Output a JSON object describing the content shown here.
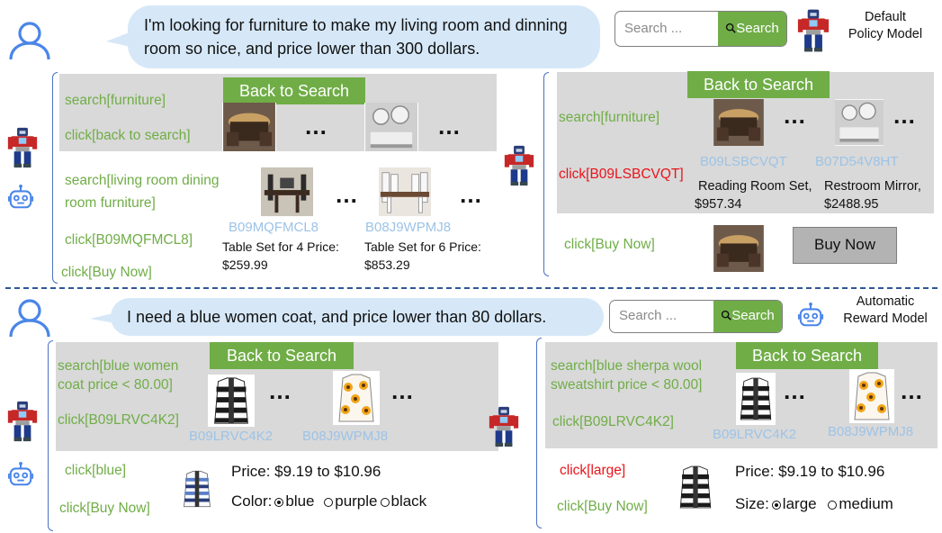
{
  "top": {
    "query": "I'm looking for furniture to make my living room and dinning room so nice, and price lower than 300 dollars.",
    "search_placeholder": "Search ...",
    "search_button": "Search",
    "model_label_line1": "Default",
    "model_label_line2": "Policy Model",
    "left": {
      "back_button": "Back to Search",
      "dots": "…",
      "cmd1": "search[furniture]",
      "cmd2": "click[back to search]",
      "cmd3_line1": "search[living room dining",
      "cmd3_line2": "room furniture]",
      "cmd4": "click[B09MQFMCL8]",
      "cmd5": "click[Buy Now]",
      "asin1": "B09MQFMCL8",
      "asin2": "B08J9WPMJ8",
      "desc1_line1": "Table Set for 4 Price:",
      "desc1_line2": "$259.99",
      "desc2_line1": "Table Set for 6 Price:",
      "desc2_line2": "$853.29"
    },
    "right": {
      "back_button": "Back to Search",
      "dots": "…",
      "cmd1": "search[furniture]",
      "cmd2": "click[B09LSBCVQT]",
      "cmd3": "click[Buy Now]",
      "asin1": "B09LSBCVQT",
      "asin2": "B07D54V8HT",
      "desc1_line1": "Reading Room Set,",
      "desc1_line2": "$957.34",
      "desc2_line1": "Restroom Mirror,",
      "desc2_line2": "$2488.95",
      "buy_now": "Buy Now"
    }
  },
  "bottom": {
    "query": "I need a blue women coat, and price lower than 80 dollars.",
    "search_placeholder": "Search ...",
    "search_button": "Search",
    "model_label_line1": "Automatic",
    "model_label_line2": "Reward Model",
    "left": {
      "back_button": "Back to Search",
      "dots": "…",
      "cmd1_line1": "search[blue women",
      "cmd1_line2": "coat price < 80.00]",
      "cmd2": "click[B09LRVC4K2]",
      "cmd3": "click[blue]",
      "cmd4": "click[Buy Now]",
      "asin1": "B09LRVC4K2",
      "asin2": "B08J9WPMJ8",
      "price": "Price: $9.19 to $10.96",
      "option_label": "Color:",
      "opt1": "blue",
      "opt2": "purple",
      "opt3": "black"
    },
    "right": {
      "back_button": "Back to Search",
      "dots": "…",
      "cmd1_line1": "search[blue sherpa wool",
      "cmd1_line2": "sweatshirt price < 80.00]",
      "cmd2": "click[B09LRVC4K2]",
      "cmd3": "click[large]",
      "cmd4": "click[Buy Now]",
      "asin1": "B09LRVC4K2",
      "asin2": "B08J9WPMJ8",
      "price": "Price: $9.19 to $10.96",
      "option_label": "Size:",
      "opt1": "large",
      "opt2": "medium"
    }
  },
  "colors": {
    "green": "#70ad47",
    "red": "#e8141b",
    "asin_blue": "#9dc3e6",
    "panel_gray": "#d9d9d9",
    "bubble_blue": "#d6e8f8",
    "divider": "#2f5597"
  },
  "icons": [
    "user-icon",
    "robot-policy-icon",
    "robot-reward-icon",
    "search-icon",
    "product-image"
  ]
}
